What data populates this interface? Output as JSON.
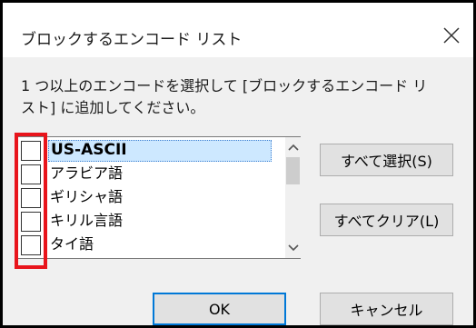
{
  "dialog": {
    "title": "ブロックするエンコード リスト",
    "close_glyph": "×"
  },
  "prompt": {
    "line1": "1 つ以上のエンコードを選択して [ブロックするエンコード リ",
    "line2": "スト] に追加してください。"
  },
  "list": {
    "items": [
      {
        "label": "US-ASCII",
        "checked": false,
        "selected": true
      },
      {
        "label": "アラビア語",
        "checked": false,
        "selected": false
      },
      {
        "label": "ギリシャ語",
        "checked": false,
        "selected": false
      },
      {
        "label": "キリル言語",
        "checked": false,
        "selected": false
      },
      {
        "label": "タイ語",
        "checked": false,
        "selected": false
      }
    ]
  },
  "buttons": {
    "select_all": "すべて選択(S)",
    "clear_all": "すべてクリア(L)",
    "ok": "OK",
    "cancel": "キャンセル"
  },
  "colors": {
    "highlight_border": "#e8141b",
    "selection_fill": "#cde8ff",
    "default_button_border": "#0078d7"
  },
  "icons": {
    "close": "close-icon",
    "scroll_up": "chevron-up-icon",
    "scroll_down": "chevron-down-icon"
  }
}
